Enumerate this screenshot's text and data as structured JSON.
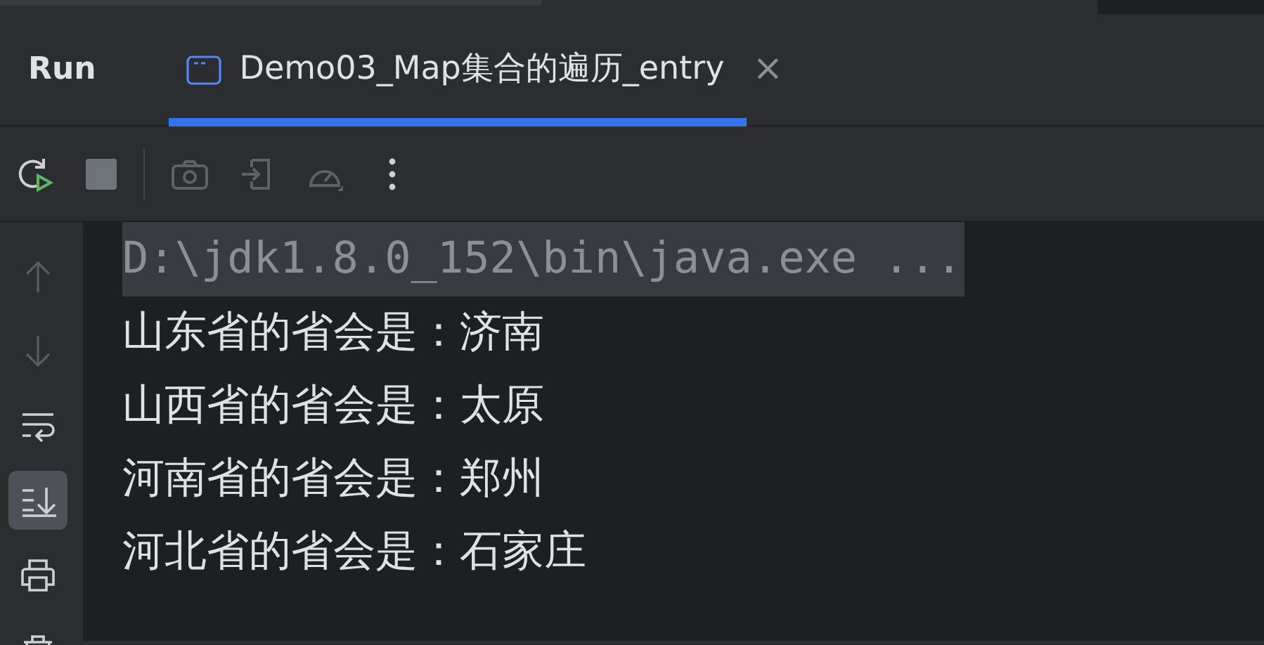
{
  "tool_window": {
    "title": "Run"
  },
  "tabs": [
    {
      "label": "Demo03_Map集合的遍历_entry",
      "selected": true,
      "close": "×"
    }
  ],
  "toolbar": [
    {
      "kind": "rerun",
      "disabled": false
    },
    {
      "kind": "stop",
      "disabled": false
    },
    {
      "kind": "separator"
    },
    {
      "kind": "camera",
      "disabled": true
    },
    {
      "kind": "import",
      "disabled": true
    },
    {
      "kind": "gauge",
      "disabled": true
    },
    {
      "kind": "more",
      "disabled": false
    }
  ],
  "sidebar": [
    {
      "kind": "up",
      "disabled": true,
      "selected": false
    },
    {
      "kind": "down",
      "disabled": true,
      "selected": false
    },
    {
      "kind": "wrap",
      "disabled": false,
      "selected": false
    },
    {
      "kind": "scroll-end",
      "disabled": false,
      "selected": true
    },
    {
      "kind": "print",
      "disabled": false,
      "selected": false
    },
    {
      "kind": "trash",
      "disabled": false,
      "selected": false
    }
  ],
  "console": [
    {
      "kind": "command",
      "text": "D:\\jdk1.8.0_152\\bin\\java.exe ..."
    },
    {
      "kind": "output",
      "text": "山东省的省会是：济南"
    },
    {
      "kind": "output",
      "text": "山西省的省会是：太原"
    },
    {
      "kind": "output",
      "text": "河南省的省会是：郑州"
    },
    {
      "kind": "output",
      "text": "河北省的省会是：石家庄"
    }
  ]
}
